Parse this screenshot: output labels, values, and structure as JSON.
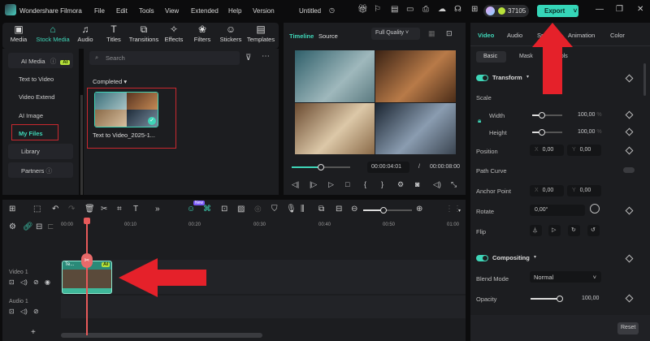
{
  "app": {
    "name": "Wondershare Filmora",
    "project": "Untitled",
    "credits": "37105",
    "export": "Export"
  },
  "menu": [
    "File",
    "Edit",
    "Tools",
    "View",
    "Extended",
    "Help",
    "Version"
  ],
  "tabs": [
    {
      "label": "Media",
      "icon": "▣"
    },
    {
      "label": "Stock Media",
      "icon": "⌂"
    },
    {
      "label": "Audio",
      "icon": "♫"
    },
    {
      "label": "Titles",
      "icon": "T"
    },
    {
      "label": "Transitions",
      "icon": "⧉"
    },
    {
      "label": "Effects",
      "icon": "✧"
    },
    {
      "label": "Filters",
      "icon": "❀"
    },
    {
      "label": "Stickers",
      "icon": "☺"
    },
    {
      "label": "Templates",
      "icon": "▤"
    }
  ],
  "sidebar": {
    "ai_media": "AI Media",
    "ai_badge": "AI",
    "items": [
      "Text to Video",
      "Video Extend",
      "AI Image",
      "My Files"
    ],
    "library": "Library",
    "partners": "Partners"
  },
  "media": {
    "search_placeholder": "Search",
    "section": "Completed",
    "file_name": "Text to Video_2025-1..."
  },
  "preview": {
    "tab_timeline": "Timeline",
    "tab_source": "Source",
    "quality": "Full Quality",
    "current_time": "00:00:04:01",
    "separator": "/",
    "total_time": "00:00:08:00",
    "progress": 0.5
  },
  "right": {
    "tabs": [
      "Video",
      "Audio",
      "Speed",
      "Animation",
      "Color"
    ],
    "subtabs": [
      "Basic",
      "Mask",
      "AI Tools"
    ],
    "transform": "Transform",
    "scale": "Scale",
    "width": "Width",
    "width_value": "100,00",
    "height": "Height",
    "height_value": "100,00",
    "percent": "%",
    "position": "Position",
    "pos_x": "0,00",
    "pos_y": "0,00",
    "x": "X",
    "y": "Y",
    "path_curve": "Path Curve",
    "anchor_point": "Anchor Point",
    "anchor_x": "0,00",
    "anchor_y": "0,00",
    "rotate": "Rotate",
    "rotate_value": "0,00°",
    "flip": "Flip",
    "compositing": "Compositing",
    "blend_mode": "Blend Mode",
    "blend_value": "Normal",
    "opacity": "Opacity",
    "opacity_value": "100,00",
    "reset": "Reset"
  },
  "timeline": {
    "ruler": [
      "00:00",
      "00:10",
      "00:20",
      "00:30",
      "00:40",
      "00:50",
      "01:00"
    ],
    "video_track": "Video 1",
    "audio_track": "Audio 1",
    "clip_label": "Te...",
    "clip_badge": "AI",
    "new_badge": "New"
  }
}
